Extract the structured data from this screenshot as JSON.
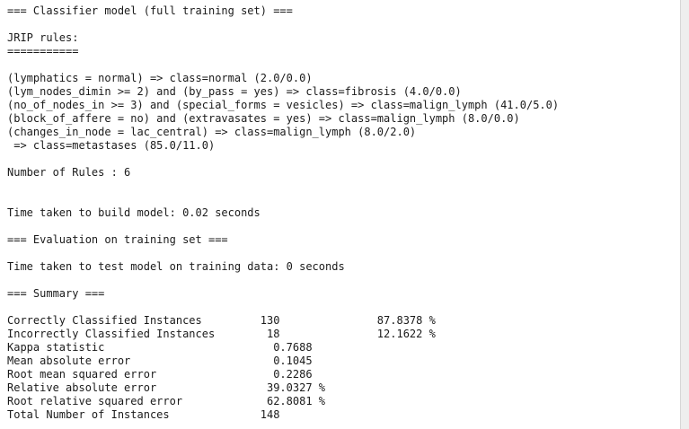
{
  "output": {
    "header": "=== Classifier model (full training set) ===",
    "rules_title": "JRIP rules:",
    "rules_underline": "===========",
    "rules": [
      "(lymphatics = normal) => class=normal (2.0/0.0)",
      "(lym_nodes_dimin >= 2) and (by_pass = yes) => class=fibrosis (4.0/0.0)",
      "(no_of_nodes_in >= 3) and (special_forms = vesicles) => class=malign_lymph (41.0/5.0)",
      "(block_of_affere = no) and (extravasates = yes) => class=malign_lymph (8.0/0.0)",
      "(changes_in_node = lac_central) => class=malign_lymph (8.0/2.0)",
      " => class=metastases (85.0/11.0)"
    ],
    "num_rules": "Number of Rules : 6",
    "build_time": "Time taken to build model: 0.02 seconds",
    "eval_header": "=== Evaluation on training set ===",
    "test_time": "Time taken to test model on training data: 0 seconds",
    "summary_header": "=== Summary ===",
    "summary": [
      "Correctly Classified Instances         130               87.8378 %",
      "Incorrectly Classified Instances        18               12.1622 %",
      "Kappa statistic                          0.7688",
      "Mean absolute error                      0.1045",
      "Root mean squared error                  0.2286",
      "Relative absolute error                 39.0327 %",
      "Root relative squared error             62.8081 %",
      "Total Number of Instances              148"
    ]
  }
}
